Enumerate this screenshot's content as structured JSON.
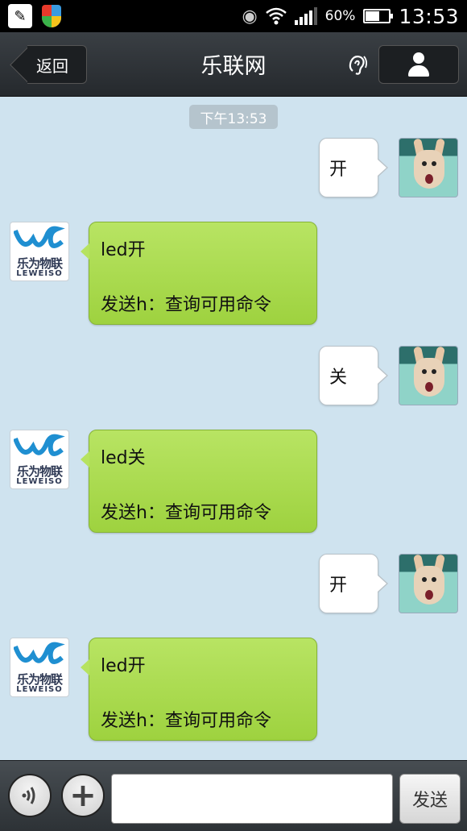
{
  "status_bar": {
    "battery_percent": "60%",
    "battery_level": 0.6,
    "time": "13:53",
    "signal_bars": 4
  },
  "header": {
    "back_label": "返回",
    "title": "乐联网"
  },
  "chat": {
    "timestamp": "下午13:53",
    "bot_logo": {
      "name_cn": "乐为物联",
      "name_en": "LEWEISO"
    },
    "messages": [
      {
        "from": "me",
        "text": "开"
      },
      {
        "from": "bot",
        "line1": "led开",
        "line2": "发送h：查询可用命令"
      },
      {
        "from": "me",
        "text": "关"
      },
      {
        "from": "bot",
        "line1": "led关",
        "line2": "发送h：查询可用命令"
      },
      {
        "from": "me",
        "text": "开"
      },
      {
        "from": "bot",
        "line1": "led开",
        "line2": "发送h：查询可用命令"
      }
    ]
  },
  "input_bar": {
    "text_value": "",
    "send_label": "发送"
  },
  "colors": {
    "chat_background": "#cfe3ef",
    "bot_bubble": "#a9dc4b",
    "header_background": "#2f3338"
  },
  "icons": [
    "notes-icon",
    "shield-icon",
    "eye-icon",
    "wifi-icon",
    "signal-icon",
    "battery-icon",
    "ear-icon",
    "person-icon",
    "voice-icon",
    "plus-icon"
  ]
}
